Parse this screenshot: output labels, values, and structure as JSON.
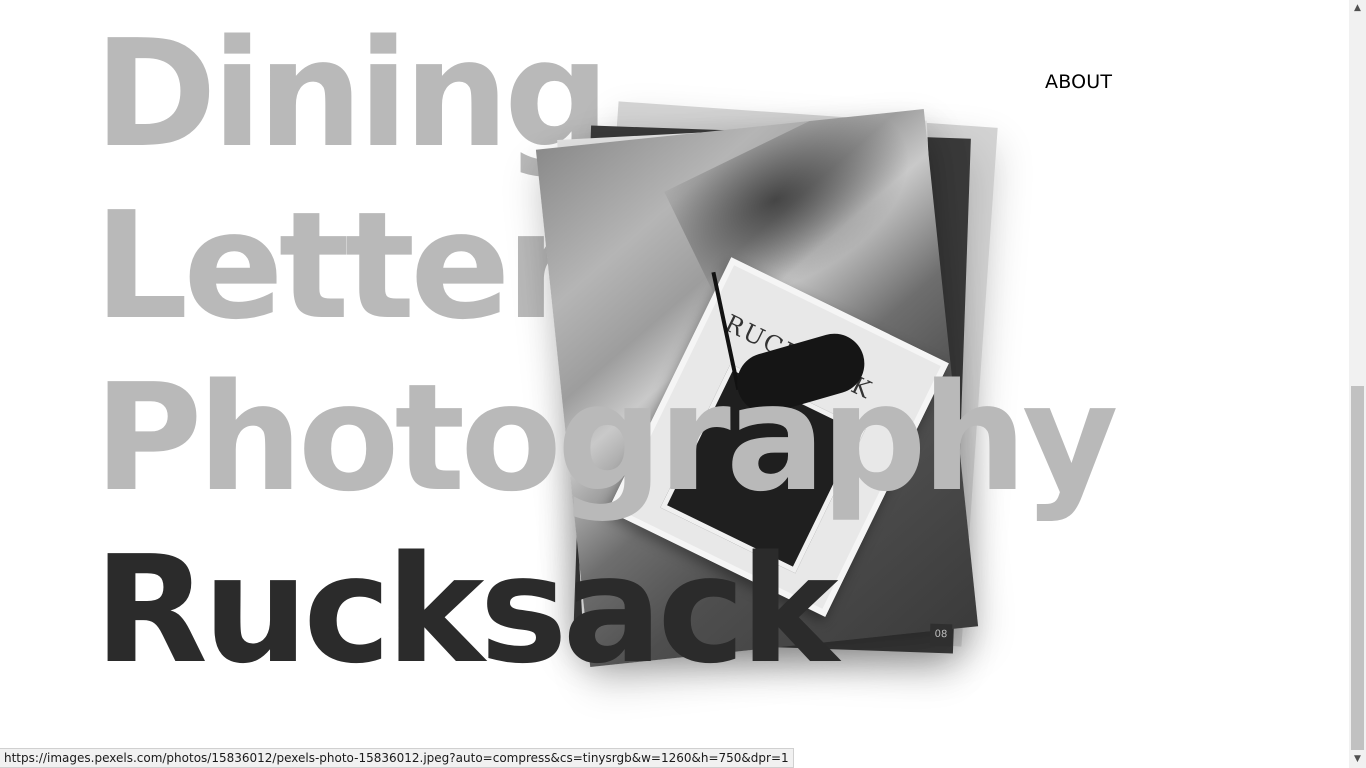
{
  "menu": {
    "items": [
      {
        "label": "Dining",
        "active": false
      },
      {
        "label": "Letters",
        "active": false
      },
      {
        "label": "Photography",
        "active": false
      },
      {
        "label": "Rucksack",
        "active": true
      }
    ]
  },
  "nav": {
    "about_label": "ABOUT"
  },
  "preview": {
    "book_title": "RUCKSACK",
    "tag": "08"
  },
  "status_bar": {
    "url": "https://images.pexels.com/photos/15836012/pexels-photo-15836012.jpeg?auto=compress&cs=tinysrgb&w=1260&h=750&dpr=1"
  },
  "colors": {
    "inactive_item": "#b9b9b9",
    "active_item": "#2b2b2b",
    "background": "#ffffff"
  }
}
